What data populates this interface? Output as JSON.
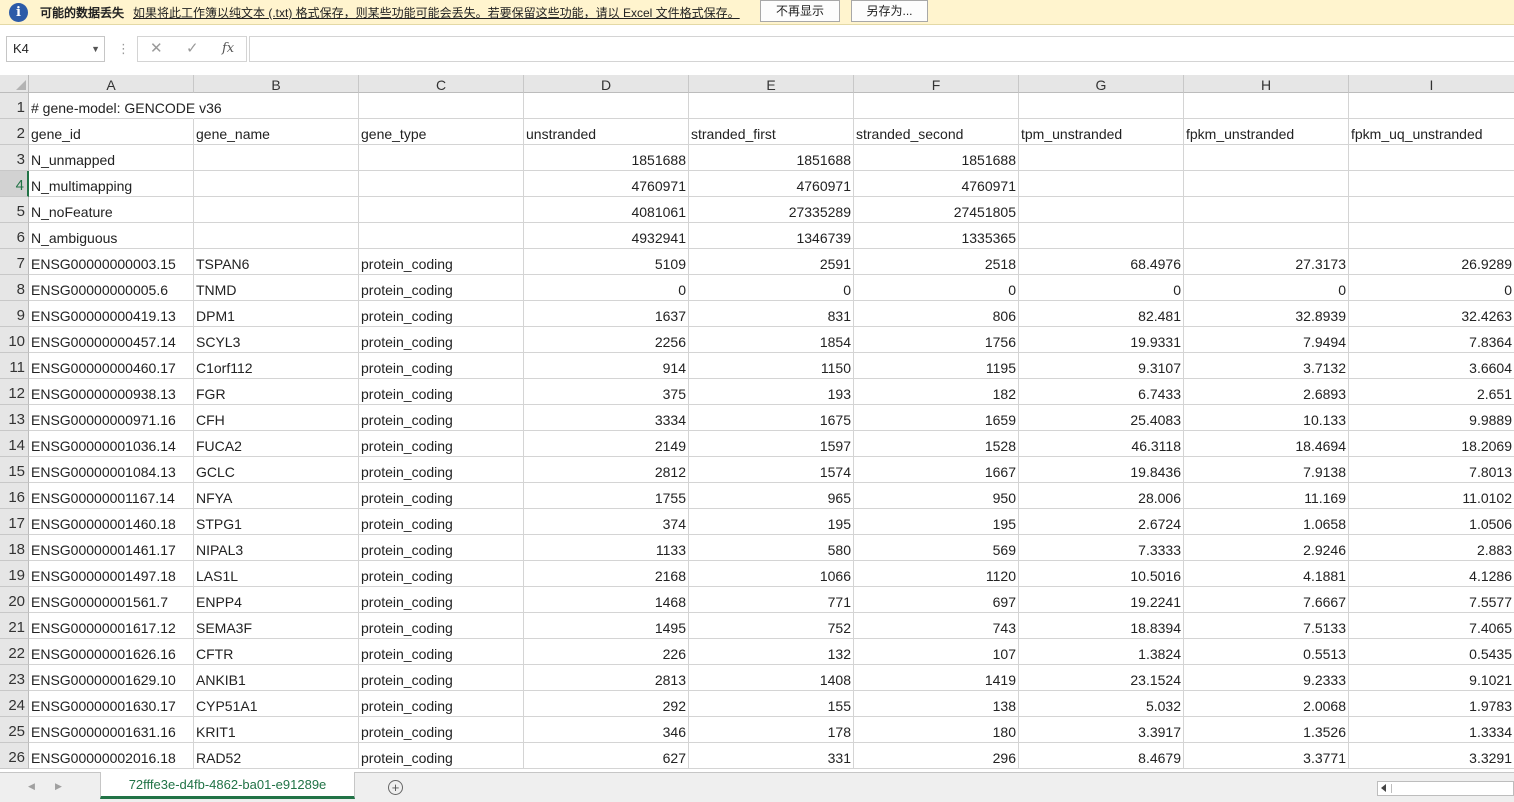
{
  "message_bar": {
    "icon": "info-icon",
    "title": "可能的数据丢失",
    "text": "如果将此工作簿以纯文本 (.txt) 格式保存，则某些功能可能会丢失。若要保留这些功能，请以 Excel 文件格式保存。",
    "dont_show_label": "不再显示",
    "save_as_label": "另存为..."
  },
  "formula_bar": {
    "name_box": "K4",
    "cancel_icon": "✕",
    "enter_icon": "✓",
    "fx_label": "fx",
    "formula": ""
  },
  "columns": [
    "A",
    "B",
    "C",
    "D",
    "E",
    "F",
    "G",
    "H",
    "I"
  ],
  "rows": [
    {
      "n": "1",
      "cells": [
        "# gene-model: GENCODE v36",
        "",
        "",
        "",
        "",
        "",
        "",
        "",
        ""
      ]
    },
    {
      "n": "2",
      "cells": [
        "gene_id",
        "gene_name",
        "gene_type",
        "unstranded",
        "stranded_first",
        "stranded_second",
        "tpm_unstranded",
        "fpkm_unstranded",
        "fpkm_uq_unstranded"
      ]
    },
    {
      "n": "3",
      "cells": [
        "N_unmapped",
        "",
        "",
        "1851688",
        "1851688",
        "1851688",
        "",
        "",
        ""
      ]
    },
    {
      "n": "4",
      "cells": [
        "N_multimapping",
        "",
        "",
        "4760971",
        "4760971",
        "4760971",
        "",
        "",
        ""
      ]
    },
    {
      "n": "5",
      "cells": [
        "N_noFeature",
        "",
        "",
        "4081061",
        "27335289",
        "27451805",
        "",
        "",
        ""
      ]
    },
    {
      "n": "6",
      "cells": [
        "N_ambiguous",
        "",
        "",
        "4932941",
        "1346739",
        "1335365",
        "",
        "",
        ""
      ]
    },
    {
      "n": "7",
      "cells": [
        "ENSG00000000003.15",
        "TSPAN6",
        "protein_coding",
        "5109",
        "2591",
        "2518",
        "68.4976",
        "27.3173",
        "26.9289"
      ]
    },
    {
      "n": "8",
      "cells": [
        "ENSG00000000005.6",
        "TNMD",
        "protein_coding",
        "0",
        "0",
        "0",
        "0",
        "0",
        "0"
      ]
    },
    {
      "n": "9",
      "cells": [
        "ENSG00000000419.13",
        "DPM1",
        "protein_coding",
        "1637",
        "831",
        "806",
        "82.481",
        "32.8939",
        "32.4263"
      ]
    },
    {
      "n": "10",
      "cells": [
        "ENSG00000000457.14",
        "SCYL3",
        "protein_coding",
        "2256",
        "1854",
        "1756",
        "19.9331",
        "7.9494",
        "7.8364"
      ]
    },
    {
      "n": "11",
      "cells": [
        "ENSG00000000460.17",
        "C1orf112",
        "protein_coding",
        "914",
        "1150",
        "1195",
        "9.3107",
        "3.7132",
        "3.6604"
      ]
    },
    {
      "n": "12",
      "cells": [
        "ENSG00000000938.13",
        "FGR",
        "protein_coding",
        "375",
        "193",
        "182",
        "6.7433",
        "2.6893",
        "2.651"
      ]
    },
    {
      "n": "13",
      "cells": [
        "ENSG00000000971.16",
        "CFH",
        "protein_coding",
        "3334",
        "1675",
        "1659",
        "25.4083",
        "10.133",
        "9.9889"
      ]
    },
    {
      "n": "14",
      "cells": [
        "ENSG00000001036.14",
        "FUCA2",
        "protein_coding",
        "2149",
        "1597",
        "1528",
        "46.3118",
        "18.4694",
        "18.2069"
      ]
    },
    {
      "n": "15",
      "cells": [
        "ENSG00000001084.13",
        "GCLC",
        "protein_coding",
        "2812",
        "1574",
        "1667",
        "19.8436",
        "7.9138",
        "7.8013"
      ]
    },
    {
      "n": "16",
      "cells": [
        "ENSG00000001167.14",
        "NFYA",
        "protein_coding",
        "1755",
        "965",
        "950",
        "28.006",
        "11.169",
        "11.0102"
      ]
    },
    {
      "n": "17",
      "cells": [
        "ENSG00000001460.18",
        "STPG1",
        "protein_coding",
        "374",
        "195",
        "195",
        "2.6724",
        "1.0658",
        "1.0506"
      ]
    },
    {
      "n": "18",
      "cells": [
        "ENSG00000001461.17",
        "NIPAL3",
        "protein_coding",
        "1133",
        "580",
        "569",
        "7.3333",
        "2.9246",
        "2.883"
      ]
    },
    {
      "n": "19",
      "cells": [
        "ENSG00000001497.18",
        "LAS1L",
        "protein_coding",
        "2168",
        "1066",
        "1120",
        "10.5016",
        "4.1881",
        "4.1286"
      ]
    },
    {
      "n": "20",
      "cells": [
        "ENSG00000001561.7",
        "ENPP4",
        "protein_coding",
        "1468",
        "771",
        "697",
        "19.2241",
        "7.6667",
        "7.5577"
      ]
    },
    {
      "n": "21",
      "cells": [
        "ENSG00000001617.12",
        "SEMA3F",
        "protein_coding",
        "1495",
        "752",
        "743",
        "18.8394",
        "7.5133",
        "7.4065"
      ]
    },
    {
      "n": "22",
      "cells": [
        "ENSG00000001626.16",
        "CFTR",
        "protein_coding",
        "226",
        "132",
        "107",
        "1.3824",
        "0.5513",
        "0.5435"
      ]
    },
    {
      "n": "23",
      "cells": [
        "ENSG00000001629.10",
        "ANKIB1",
        "protein_coding",
        "2813",
        "1408",
        "1419",
        "23.1524",
        "9.2333",
        "9.1021"
      ]
    },
    {
      "n": "24",
      "cells": [
        "ENSG00000001630.17",
        "CYP51A1",
        "protein_coding",
        "292",
        "155",
        "138",
        "5.032",
        "2.0068",
        "1.9783"
      ]
    },
    {
      "n": "25",
      "cells": [
        "ENSG00000001631.16",
        "KRIT1",
        "protein_coding",
        "346",
        "178",
        "180",
        "3.3917",
        "1.3526",
        "1.3334"
      ]
    },
    {
      "n": "26",
      "cells": [
        "ENSG00000002016.18",
        "RAD52",
        "protein_coding",
        "627",
        "331",
        "296",
        "8.4679",
        "3.3771",
        "3.3291"
      ]
    }
  ],
  "sheet_tabs": {
    "active": "72fffe3e-d4fb-4862-ba01-e91289e",
    "add_label": "+"
  },
  "selected_row": "4",
  "accent_color": "#217346"
}
